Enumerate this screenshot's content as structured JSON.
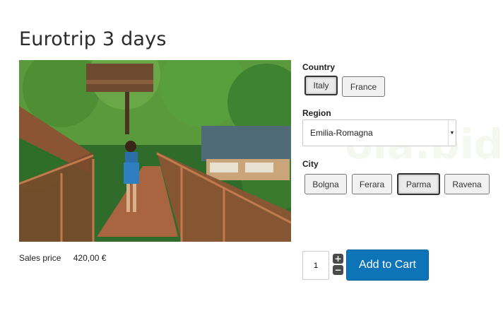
{
  "product": {
    "title": "Eurotrip 3 days",
    "image_alt": "treehouse-walkway-forest-photo"
  },
  "pricing": {
    "label": "Sales price",
    "amount": "420,00 €"
  },
  "country": {
    "label": "Country",
    "options": [
      "Italy",
      "France"
    ],
    "selected": "Italy"
  },
  "region": {
    "label": "Region",
    "value": "Emilia-Romagna"
  },
  "city": {
    "label": "City",
    "options": [
      "Bolgna",
      "Ferara",
      "Parma",
      "Ravena"
    ],
    "selected": "Parma"
  },
  "cart": {
    "quantity": "1",
    "plus_symbol": "+",
    "minus_symbol": "−",
    "button_label": "Add to Cart"
  },
  "watermark": {
    "text": "ola.bid"
  },
  "colors": {
    "cart_button": "#0e74b8",
    "title_text": "#2b2b2b"
  },
  "icons": {
    "region_dropdown": "chevron-down-icon",
    "increment": "plus-icon",
    "decrement": "minus-icon"
  }
}
